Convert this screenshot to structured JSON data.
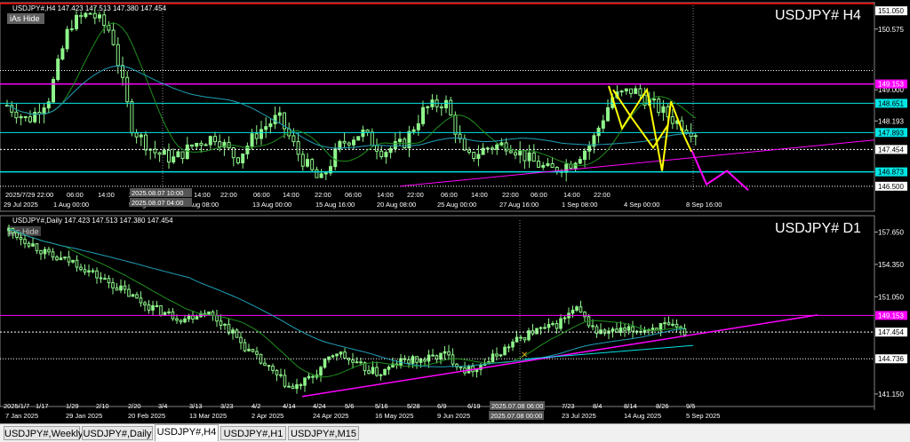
{
  "colors": {
    "background": "#000000",
    "grid": "#444444",
    "candle": "#8ef58a",
    "ma_fast": "#1f8f1f",
    "ma_slow": "#1fa0b8",
    "magenta": "#ff00ff",
    "cyan": "#00e5e5",
    "yellow": "#ffff00",
    "price_label_bg_magenta": "#ff00ff",
    "price_label_bg_cyan": "#00e5e5"
  },
  "top_panel": {
    "header": "USDJPY#,H4  147.423 147.513 147.380 147.454",
    "watermark": "USDJPY# H4",
    "indicator_label": "iAs Hide",
    "price_axis": [
      "151.050",
      "150.575",
      "149.500",
      "149.000",
      "148.651",
      "148.193",
      "147.893",
      "147.454",
      "146.873",
      "146.500"
    ],
    "price_labels": [
      {
        "text": "149.153",
        "style": "magenta"
      },
      {
        "text": "148.651",
        "style": "cyan"
      },
      {
        "text": "147.893",
        "style": "cyan"
      },
      {
        "text": "147.454",
        "style": "plain"
      },
      {
        "text": "146.873",
        "style": "cyan"
      },
      {
        "text": "146.500",
        "style": "plain"
      },
      {
        "text": "151.050",
        "style": "plain"
      }
    ],
    "time_axis": [
      "29 Jul 2025",
      "1 Aug 00:00",
      "5 Aug 00:00",
      "8 Aug 08:00",
      "13 Aug 00:00",
      "15 Aug 16:00",
      "20 Aug 08:00",
      "25 Aug 00:00",
      "27 Aug 16:00",
      "1 Sep 08:00",
      "4 Sep 00:00",
      "8 Sep 16:00"
    ],
    "hour_axis": [
      "2025/7/29 22:00",
      "06:00",
      "14:00",
      "22",
      "14:00",
      "22:00",
      "06:00",
      "14:00",
      "22:00",
      "06:00",
      "14:00",
      "22:00",
      "06:00",
      "14:00",
      "22:00",
      "06:00",
      "14:00",
      "22:00"
    ],
    "crosshair_time": "2025.08.07 10:00",
    "crosshair_time_2": "2025.08.07 04:00"
  },
  "bottom_panel": {
    "header": "USDJPY#,Daily  147.423 147.513 147.380 147.454",
    "watermark": "USDJPY# D1",
    "indicator_label": "iAs Hide",
    "price_axis": [
      "157.650",
      "154.350",
      "151.050",
      "147.454",
      "144.736",
      "141.150"
    ],
    "price_labels": [
      {
        "text": "149.153",
        "style": "magenta"
      },
      {
        "text": "147.454",
        "style": "plain"
      },
      {
        "text": "144.736",
        "style": "plain"
      }
    ],
    "time_axis": [
      "7 Jan 2025",
      "29 Jan 2025",
      "20 Feb 2025",
      "13 Mar 2025",
      "2 Apr 2025",
      "24 Apr 2025",
      "16 May 2025",
      "9 Jun 2025",
      "2025.07.08 00:00",
      "23 Jul 2025",
      "14 Aug 2025",
      "5 Sep 2025"
    ],
    "date_axis": [
      "2025/1/7",
      "1/17",
      "1/29",
      "2/10",
      "2/20",
      "3/4",
      "3/13",
      "3/23",
      "4/2",
      "4/14",
      "4/24",
      "5/6",
      "5/16",
      "5/28",
      "6/9",
      "6/19",
      "2025.07.08 06:00",
      "7/23",
      "8/4",
      "8/14",
      "8/26",
      "9/5"
    ]
  },
  "tabs": [
    {
      "label": "USDJPY#,Weekly",
      "active": false
    },
    {
      "label": "USDJPY#,Daily",
      "active": false
    },
    {
      "label": "USDJPY#,H4",
      "active": true
    },
    {
      "label": "USDJPY#,H1",
      "active": false
    },
    {
      "label": "USDJPY#,M15",
      "active": false
    }
  ]
}
